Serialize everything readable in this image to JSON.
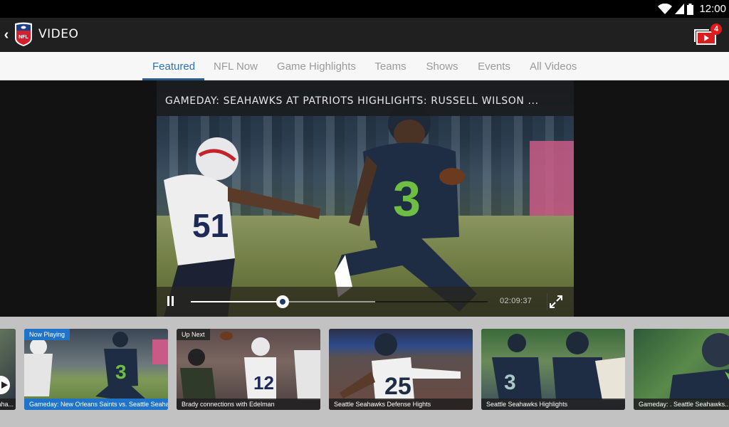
{
  "status_bar": {
    "time": "12:00",
    "icons": [
      "wifi-icon",
      "signal-icon",
      "battery-icon"
    ]
  },
  "action_bar": {
    "back_icon": "chevron-left-icon",
    "back_glyph": "‹",
    "logo": "NFL",
    "title": "VIDEO",
    "queue_icon": "video-queue-icon",
    "queue_badge": "4",
    "accent_color": "#e11a1a"
  },
  "tabs": [
    {
      "label": "Featured",
      "active": true
    },
    {
      "label": "NFL Now",
      "active": false
    },
    {
      "label": "Game Highlights",
      "active": false
    },
    {
      "label": "Teams",
      "active": false
    },
    {
      "label": "Shows",
      "active": false
    },
    {
      "label": "Events",
      "active": false
    },
    {
      "label": "All Videos",
      "active": false
    }
  ],
  "player": {
    "title": "GAMEDAY: SEAHAWKS AT PATRIOTS HIGHLIGHTS: RUSSELL WILSON ...",
    "state": "playing",
    "pause_icon": "pause-icon",
    "progress_played": 0.31,
    "progress_buffered": 0.62,
    "time": "02:09:37",
    "fullscreen_icon": "fullscreen-icon"
  },
  "carousel": {
    "cards": [
      {
        "tag": "",
        "caption": "...aha...",
        "partial": true,
        "play_icon": "play-icon"
      },
      {
        "tag": "Now Playing",
        "caption": "Gameday: New Orleans Saints vs. Seattle Seaha..."
      },
      {
        "tag": "Up Next",
        "caption": "Brady connections with Edelman"
      },
      {
        "tag": "",
        "caption": "Seattle Seahawks Defense Hights"
      },
      {
        "tag": "",
        "caption": "Seattle Seahawks Highlights"
      },
      {
        "tag": "",
        "caption": "Gameday: . Seattle Seahawks..."
      }
    ]
  },
  "colors": {
    "tab_active": "#2c73b0",
    "now_playing": "#1f74c9",
    "status_bar": "#000000",
    "action_bar": "#202020"
  }
}
